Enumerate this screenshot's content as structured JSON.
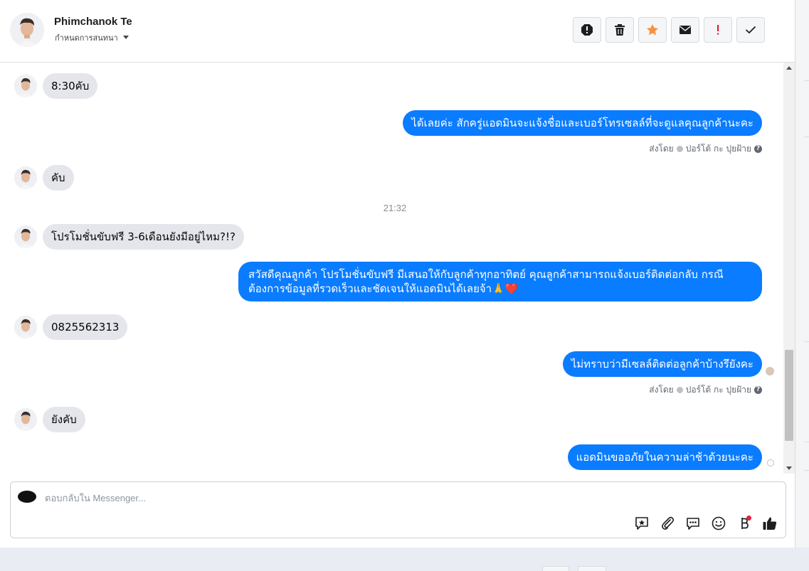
{
  "header": {
    "name": "Phimchanok Te",
    "subtitle": "กำหนดการสนทนา"
  },
  "actions": [
    {
      "name": "spam-icon",
      "color": "#1c1e21"
    },
    {
      "name": "trash-icon",
      "color": "#1c1e21"
    },
    {
      "name": "star-icon",
      "color": "#f7923b"
    },
    {
      "name": "mail-icon",
      "color": "#1c1e21"
    },
    {
      "name": "exclamation-icon",
      "color": "#e41e3f"
    },
    {
      "name": "check-icon",
      "color": "#1c1e21"
    }
  ],
  "messages": {
    "m1": "8:30คับ",
    "m2": "ได้เลยค่ะ สักครู่แอดมินจะแจ้งชื่อและเบอร์โทรเซลล์ที่จะดูแลคุณลูกค้านะคะ",
    "m3": "คับ",
    "m4": "โปรโมชั่นขับฟรี 3-6เดือนยังมีอยู่ไหม?!?",
    "m5_line1": "สวัสดีคุณลูกค้า โปรโมชั่นขับฟรี มีเสนอให้กับลูกค้าทุกอาทิตย์ คุณลูกค้าสามารถแจ้งเบอร์ติดต่อกลับ กรณี",
    "m5_line2": "ต้องการข้อมูลที่รวดเร็วและชัดเจนให้แอดมินได้เลยจ้า",
    "m5_emoji": "🙏❤️",
    "m6": "0825562313",
    "m7": "ไม่ทราบว่ามีเซลล์ติดต่อลูกค้าบ้างรึยังคะ",
    "m8": "ยังคับ",
    "m9": "แอดมินขออภัยในความล่าช้าด้วยนะคะ"
  },
  "sent_by": {
    "prefix": "ส่งโดย",
    "name": "ปอร์โต้ กะ ปุยฝ้าย",
    "help": "?"
  },
  "timestamp": "21:32",
  "composer": {
    "placeholder": "ตอบกลับใน Messenger..."
  },
  "tools": [
    "saved-reply-icon",
    "attachment-icon",
    "quick-reply-icon",
    "emoji-icon",
    "baht-payment-icon",
    "like-icon"
  ],
  "colors": {
    "outgoing": "#0a7cff",
    "incoming": "#e4e6eb",
    "accent_star": "#f7923b",
    "alert": "#e41e3f"
  }
}
